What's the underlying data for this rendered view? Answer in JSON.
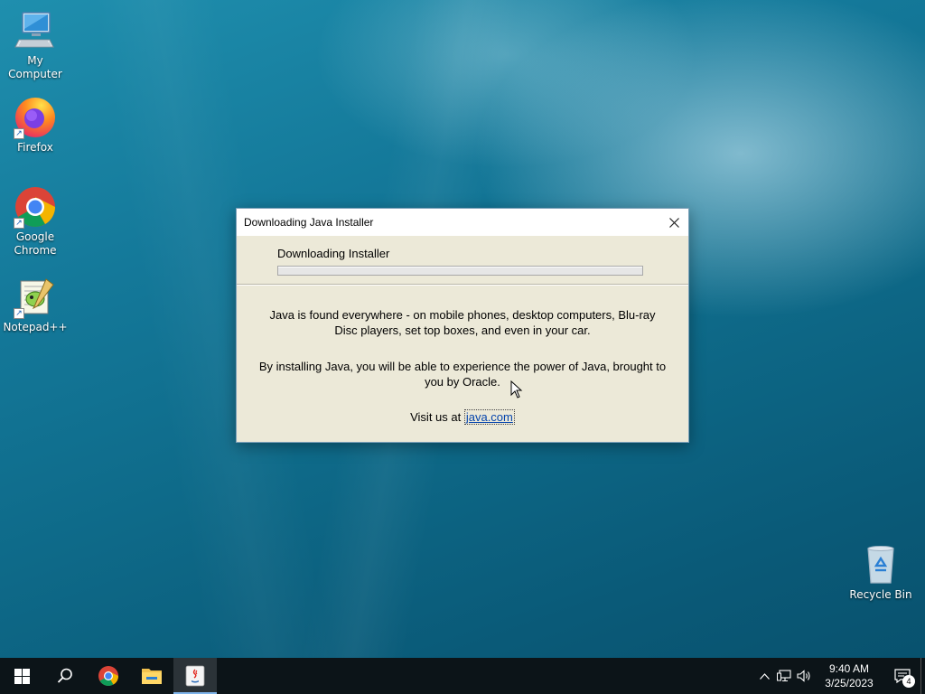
{
  "desktop": {
    "icons": [
      {
        "label": "My Computer",
        "icon": "computer-icon"
      },
      {
        "label": "Firefox",
        "icon": "firefox-icon"
      },
      {
        "label": "Google Chrome",
        "icon": "chrome-icon"
      },
      {
        "label": "Notepad++",
        "icon": "notepadpp-icon"
      },
      {
        "label": "Recycle Bin",
        "icon": "recycle-bin-icon"
      }
    ]
  },
  "dialog": {
    "title": "Downloading Java Installer",
    "status_label": "Downloading Installer",
    "progress": 0,
    "paragraph1": "Java is found everywhere - on mobile phones, desktop computers, Blu-ray Disc players, set top boxes, and even in your car.",
    "paragraph2": "By installing Java, you will be able to experience the power of Java, brought to you by Oracle.",
    "visit_prefix": "Visit us at ",
    "visit_link": "java.com"
  },
  "taskbar": {
    "pinned": [
      {
        "icon": "windows-start-icon"
      },
      {
        "icon": "search-icon"
      },
      {
        "icon": "chrome-icon"
      },
      {
        "icon": "file-explorer-icon"
      },
      {
        "icon": "java-icon",
        "active": true
      }
    ],
    "clock_time": "9:40 AM",
    "clock_date": "3/25/2023",
    "notification_count": "4"
  },
  "colors": {
    "taskbar": "#0c1418",
    "dialog_bg": "#ece9d8",
    "link": "#0645ad",
    "active_indicator": "#7eb4ea"
  }
}
